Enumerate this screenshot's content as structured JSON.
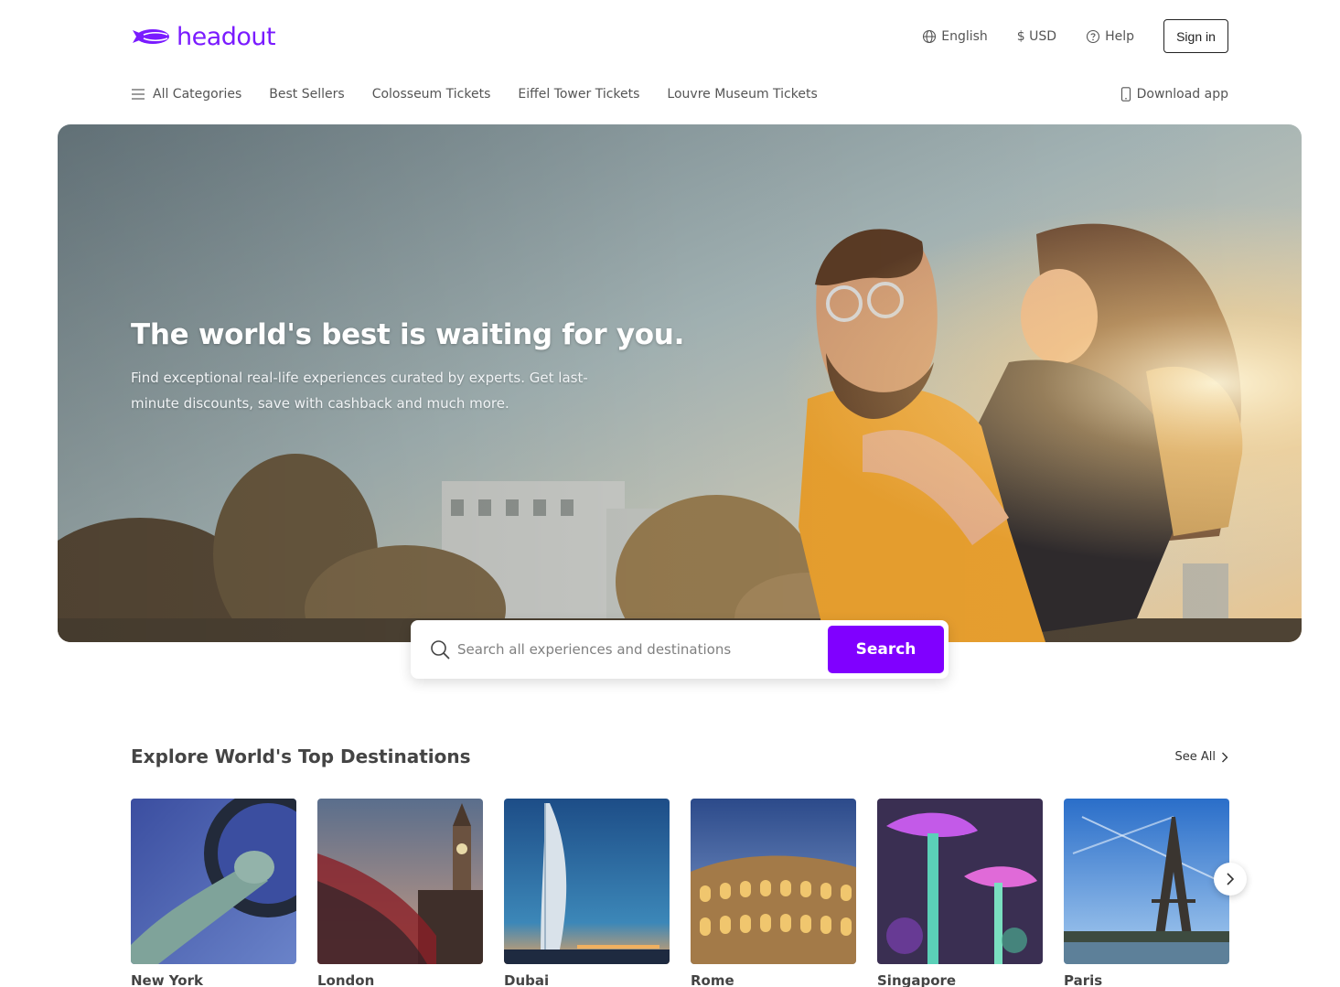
{
  "brand": {
    "name": "headout",
    "color": "#7a1bff"
  },
  "header": {
    "language": "English",
    "currency": "$ USD",
    "help": "Help",
    "sign_in": "Sign in"
  },
  "nav": {
    "all_categories": "All Categories",
    "items": [
      "Best Sellers",
      "Colosseum Tickets",
      "Eiffel Tower Tickets",
      "Louvre Museum Tickets"
    ],
    "download_app": "Download app"
  },
  "hero": {
    "title": "The world's best is waiting for you.",
    "subtitle": "Find exceptional real-life experiences curated by experts. Get last-minute discounts, save with cashback and much more."
  },
  "search": {
    "placeholder": "Search all experiences and destinations",
    "value": "",
    "button_label": "Search",
    "button_color": "#8000ff"
  },
  "destinations": {
    "title": "Explore World's Top Destinations",
    "see_all": "See All",
    "items": [
      {
        "name": "New York"
      },
      {
        "name": "London"
      },
      {
        "name": "Dubai"
      },
      {
        "name": "Rome"
      },
      {
        "name": "Singapore"
      },
      {
        "name": "Paris"
      }
    ]
  }
}
